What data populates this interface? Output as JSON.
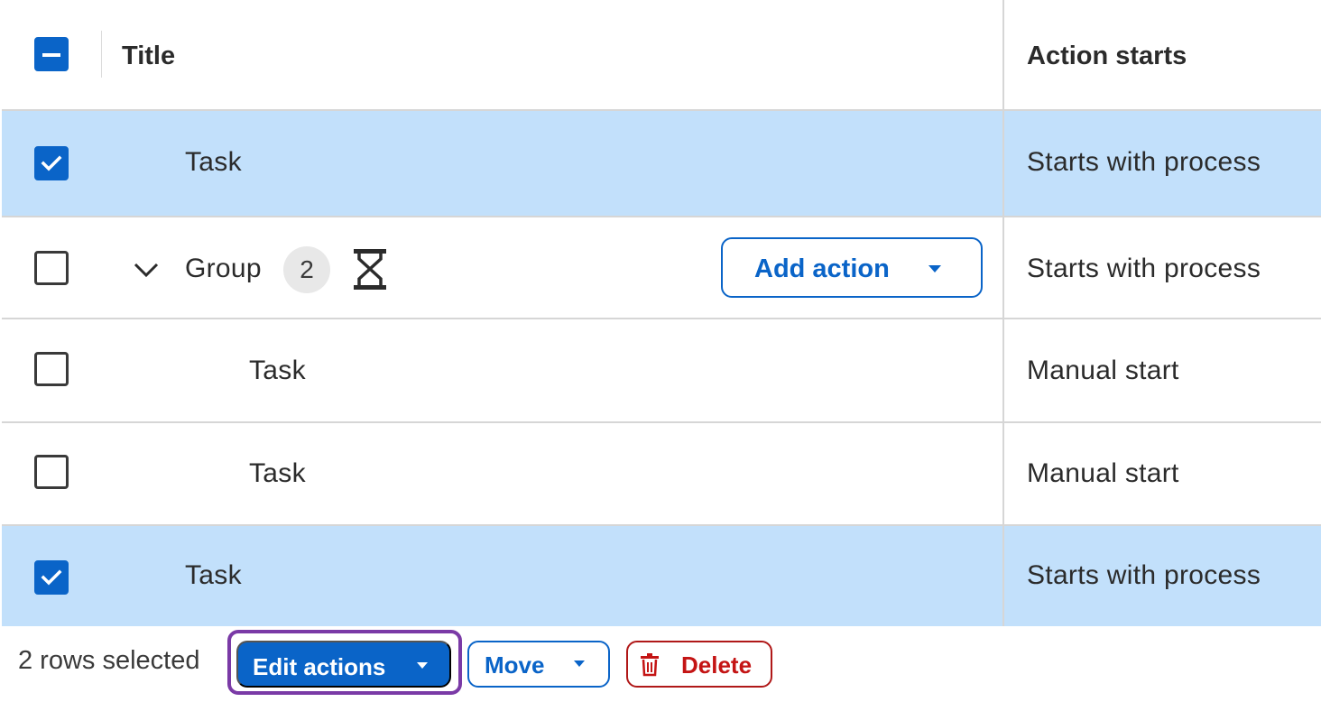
{
  "header": {
    "title_label": "Title",
    "action_starts_label": "Action starts"
  },
  "rows": [
    {
      "title": "Task",
      "action_starts": "Starts with process",
      "selected": true
    },
    {
      "title": "Group",
      "count": "2",
      "action_starts": "Starts with process",
      "selected": false,
      "add_action_label": "Add action"
    },
    {
      "title": "Task",
      "action_starts": "Manual start",
      "selected": false
    },
    {
      "title": "Task",
      "action_starts": "Manual start",
      "selected": false
    },
    {
      "title": "Task",
      "action_starts": "Starts with process",
      "selected": true
    }
  ],
  "footer": {
    "selection_text": "2 rows selected",
    "edit_actions_label": "Edit actions",
    "move_label": "Move",
    "delete_label": "Delete"
  },
  "colors": {
    "accent": "#0a64c8",
    "selected_row": "#c2e0fb",
    "danger": "#c41414",
    "focus_ring": "#7a3aa6"
  }
}
